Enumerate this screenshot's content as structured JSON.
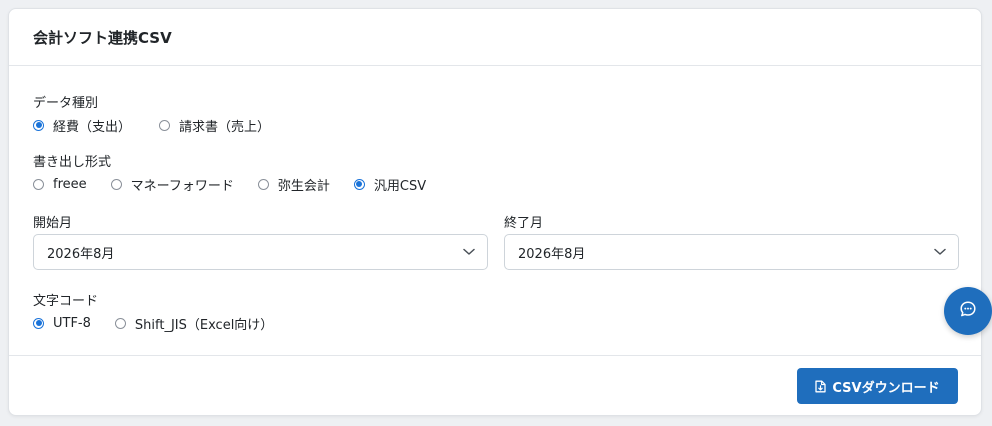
{
  "card": {
    "title": "会計ソフト連携CSV"
  },
  "data_type": {
    "label": "データ種別",
    "options": [
      {
        "label": "経費（支出）",
        "checked": true
      },
      {
        "label": "請求書（売上）",
        "checked": false
      }
    ]
  },
  "export_format": {
    "label": "書き出し形式",
    "options": [
      {
        "label": "freee",
        "checked": false
      },
      {
        "label": "マネーフォワード",
        "checked": false
      },
      {
        "label": "弥生会計",
        "checked": false
      },
      {
        "label": "汎用CSV",
        "checked": true
      }
    ]
  },
  "start_month": {
    "label": "開始月",
    "value": "2026年8月"
  },
  "end_month": {
    "label": "終了月",
    "value": "2026年8月"
  },
  "encoding": {
    "label": "文字コード",
    "options": [
      {
        "label": "UTF-8",
        "checked": true
      },
      {
        "label": "Shift_JIS（Excel向け）",
        "checked": false
      }
    ]
  },
  "footer": {
    "download_label": "CSVダウンロード"
  },
  "icons": {
    "download": "file-download-icon",
    "chat": "chat-bubble-icon",
    "chevron": "chevron-down-icon"
  },
  "colors": {
    "primary": "#1f6ebd",
    "radio_checked": "#1a73d9"
  }
}
